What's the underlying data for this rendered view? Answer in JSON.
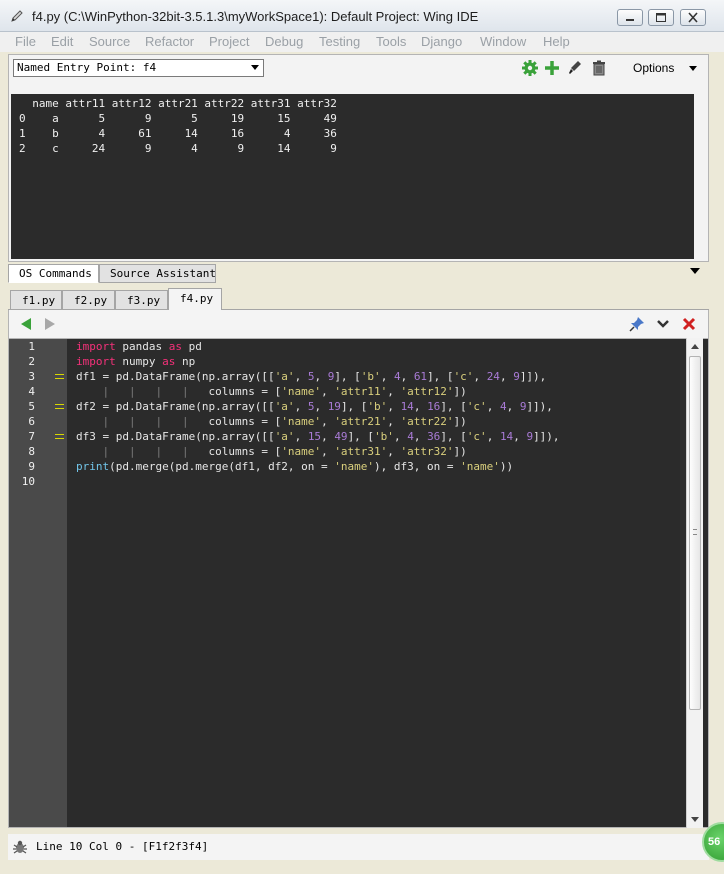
{
  "window": {
    "title": "f4.py (C:\\WinPython-32bit-3.5.1.3\\myWorkSpace1): Default Project: Wing IDE"
  },
  "menu": [
    "File",
    "Edit",
    "Source",
    "Refactor",
    "Project",
    "Debug",
    "Testing",
    "Tools",
    "Django",
    "Window",
    "Help"
  ],
  "os_commands": {
    "entry_point": "Named Entry Point: f4",
    "options_label": "Options",
    "output": [
      "  name attr11 attr12 attr21 attr22 attr31 attr32",
      "0    a      5      9      5     19     15     49",
      "1    b      4     61     14     16      4     36",
      "2    c     24      9      4      9     14      9"
    ]
  },
  "panel_tabs": [
    "OS Commands",
    "Source Assistant"
  ],
  "file_tabs": [
    "f1.py",
    "f2.py",
    "f3.py",
    "f4.py"
  ],
  "editor": {
    "line_numbers": [
      "1",
      "2",
      "3",
      "4",
      "5",
      "6",
      "7",
      "8",
      "9",
      "10"
    ],
    "lines": {
      "l1": [
        [
          "kw",
          "import"
        ],
        [
          "",
          " pandas "
        ],
        [
          "kw",
          "as"
        ],
        [
          "",
          " pd"
        ]
      ],
      "l2": [
        [
          "kw",
          "import"
        ],
        [
          "",
          " numpy "
        ],
        [
          "kw",
          "as"
        ],
        [
          "",
          " np"
        ]
      ],
      "l3": [
        [
          "",
          "df1 = pd.DataFrame(np.array([["
        ],
        [
          "str",
          "'a'"
        ],
        [
          "",
          ", "
        ],
        [
          "num",
          "5"
        ],
        [
          "",
          ", "
        ],
        [
          "num",
          "9"
        ],
        [
          "",
          "], ["
        ],
        [
          "str",
          "'b'"
        ],
        [
          "",
          ", "
        ],
        [
          "num",
          "4"
        ],
        [
          "",
          ", "
        ],
        [
          "num",
          "61"
        ],
        [
          "",
          "], ["
        ],
        [
          "str",
          "'c'"
        ],
        [
          "",
          ", "
        ],
        [
          "num",
          "24"
        ],
        [
          "",
          ", "
        ],
        [
          "num",
          "9"
        ],
        [
          "",
          "]]),"
        ]
      ],
      "l4": [
        [
          "guide",
          "    |   |   |   |   "
        ],
        [
          "",
          "columns = ["
        ],
        [
          "str",
          "'name'"
        ],
        [
          "",
          ", "
        ],
        [
          "str",
          "'attr11'"
        ],
        [
          "",
          ", "
        ],
        [
          "str",
          "'attr12'"
        ],
        [
          "",
          "])"
        ]
      ],
      "l5": [
        [
          "",
          "df2 = pd.DataFrame(np.array([["
        ],
        [
          "str",
          "'a'"
        ],
        [
          "",
          ", "
        ],
        [
          "num",
          "5"
        ],
        [
          "",
          ", "
        ],
        [
          "num",
          "19"
        ],
        [
          "",
          "], ["
        ],
        [
          "str",
          "'b'"
        ],
        [
          "",
          ", "
        ],
        [
          "num",
          "14"
        ],
        [
          "",
          ", "
        ],
        [
          "num",
          "16"
        ],
        [
          "",
          "], ["
        ],
        [
          "str",
          "'c'"
        ],
        [
          "",
          ", "
        ],
        [
          "num",
          "4"
        ],
        [
          "",
          ", "
        ],
        [
          "num",
          "9"
        ],
        [
          "",
          "]]),"
        ]
      ],
      "l6": [
        [
          "guide",
          "    |   |   |   |   "
        ],
        [
          "",
          "columns = ["
        ],
        [
          "str",
          "'name'"
        ],
        [
          "",
          ", "
        ],
        [
          "str",
          "'attr21'"
        ],
        [
          "",
          ", "
        ],
        [
          "str",
          "'attr22'"
        ],
        [
          "",
          "])"
        ]
      ],
      "l7": [
        [
          "",
          "df3 = pd.DataFrame(np.array([["
        ],
        [
          "str",
          "'a'"
        ],
        [
          "",
          ", "
        ],
        [
          "num",
          "15"
        ],
        [
          "",
          ", "
        ],
        [
          "num",
          "49"
        ],
        [
          "",
          "], ["
        ],
        [
          "str",
          "'b'"
        ],
        [
          "",
          ", "
        ],
        [
          "num",
          "4"
        ],
        [
          "",
          ", "
        ],
        [
          "num",
          "36"
        ],
        [
          "",
          "], ["
        ],
        [
          "str",
          "'c'"
        ],
        [
          "",
          ", "
        ],
        [
          "num",
          "14"
        ],
        [
          "",
          ", "
        ],
        [
          "num",
          "9"
        ],
        [
          "",
          "]]),"
        ]
      ],
      "l8": [
        [
          "guide",
          "    |   |   |   |   "
        ],
        [
          "",
          "columns = ["
        ],
        [
          "str",
          "'name'"
        ],
        [
          "",
          ", "
        ],
        [
          "str",
          "'attr31'"
        ],
        [
          "",
          ", "
        ],
        [
          "str",
          "'attr32'"
        ],
        [
          "",
          "])"
        ]
      ],
      "l9": [
        [
          "fn",
          "print"
        ],
        [
          "",
          "(pd.merge(pd.merge(df1, df2, on = "
        ],
        [
          "str",
          "'name'"
        ],
        [
          "",
          "), df3, on = "
        ],
        [
          "str",
          "'name'"
        ],
        [
          "",
          "))"
        ]
      ],
      "l10": []
    }
  },
  "status": {
    "text": "Line 10 Col 0 - [F1f2f3f4]",
    "badge": "56"
  },
  "colors": {
    "keyword": "#f5317a",
    "string": "#d9cf7d",
    "number": "#a97bd6",
    "builtin": "#72c6ea",
    "editor_bg": "#2b2b2b",
    "gutter_bg": "#4a4a4a"
  },
  "icons": {
    "title": "pencil-icon",
    "toolbar": [
      "gear-icon",
      "plus-icon",
      "brush-icon",
      "trash-icon"
    ],
    "editor_toolbar": [
      "back-arrow-icon",
      "forward-arrow-icon",
      "pin-icon",
      "chevron-down-icon",
      "close-icon"
    ],
    "status": "bug-icon"
  }
}
